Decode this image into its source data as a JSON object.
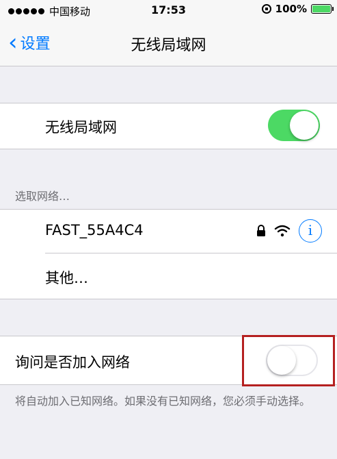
{
  "status_bar": {
    "carrier": "中国移动",
    "time": "17:53",
    "battery_percent": "100%",
    "signal_dots": 5
  },
  "nav": {
    "back_label": "设置",
    "title": "无线局域网"
  },
  "wifi": {
    "label": "无线局域网",
    "enabled": true
  },
  "networks": {
    "header": "选取网络…",
    "items": [
      {
        "name": "FAST_55A4C4",
        "locked": true
      },
      {
        "name": "其他…"
      }
    ]
  },
  "ask_to_join": {
    "label": "询问是否加入网络",
    "enabled": false,
    "footnote": "将自动加入已知网络。如果没有已知网络，您必须手动选择。"
  },
  "colors": {
    "accent": "#007aff",
    "toggle_on": "#4cd964",
    "highlight": "#b52020"
  }
}
